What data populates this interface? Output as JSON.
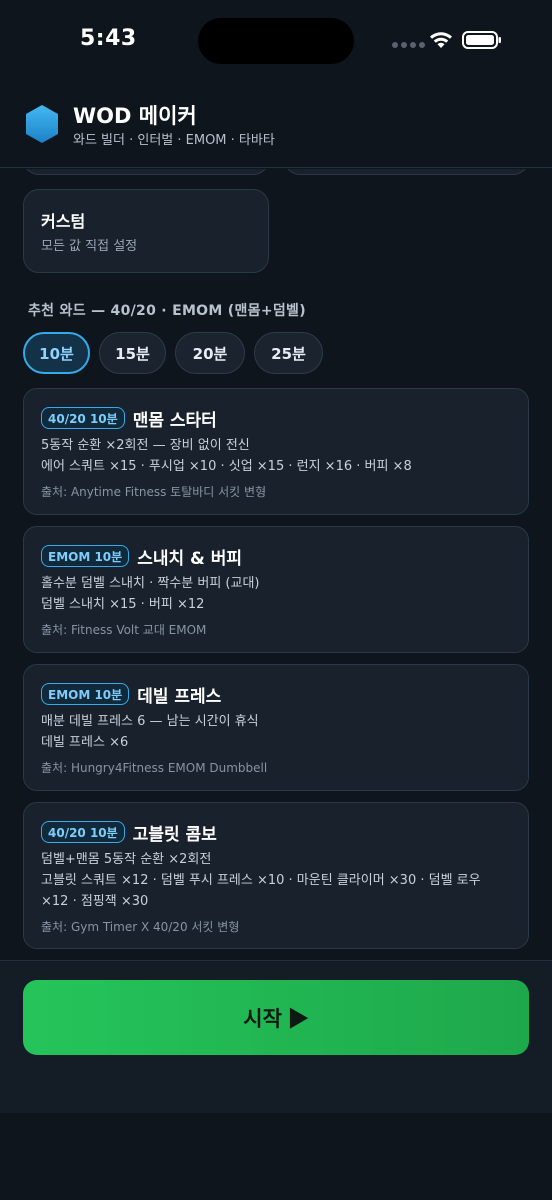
{
  "status_bar": {
    "time": "5:43"
  },
  "header": {
    "title": "WOD 메이커",
    "subtitle": "와드 빌더 · 인터벌 · EMOM · 타바타",
    "logo_color": "#2ea8e6"
  },
  "custom_card": {
    "title": "커스텀",
    "subtitle": "모든 값 직접 설정"
  },
  "recommended": {
    "title": "추천 와드 — 40/20 · EMOM (맨몸+덤벨)",
    "chips": [
      "10분",
      "15분",
      "20분",
      "25분"
    ],
    "selected_chip": "10분"
  },
  "cards": [
    {
      "badge": "40/20 10분",
      "title": "맨몸 스타터",
      "lines": [
        "5동작 순환 ×2회전 — 장비 없이 전신",
        "에어 스쿼트 ×15 · 푸시업 ×10 · 싯업 ×15 · 런지 ×16 · 버피 ×8"
      ],
      "source": "출처: Anytime Fitness 토탈바디 서킷 변형"
    },
    {
      "badge": "EMOM 10분",
      "title": "스내치 & 버피",
      "lines": [
        "홀수분 덤벨 스내치 · 짝수분 버피 (교대)",
        "덤벨 스내치 ×15 · 버피 ×12"
      ],
      "source": "출처: Fitness Volt 교대 EMOM"
    },
    {
      "badge": "EMOM 10분",
      "title": "데빌 프레스",
      "lines": [
        "매분 데빌 프레스 6 — 남는 시간이 휴식",
        "데빌 프레스 ×6"
      ],
      "source": "출처: Hungry4Fitness EMOM Dumbbell"
    },
    {
      "badge": "40/20 10분",
      "title": "고블릿 콤보",
      "lines": [
        "덤벨+맨몸 5동작 순환 ×2회전",
        "고블릿 스쿼트 ×12 · 덤벨 푸시 프레스 ×10 · 마운틴 클라이머 ×30 · 덤벨 로우",
        "×12 · 점핑잭 ×30"
      ],
      "source": "출처: Gym Timer X 40/20 서킷 변형"
    }
  ],
  "start_button": {
    "label": "시작 ▶"
  },
  "colors": {
    "accent": "#36a9e8",
    "start": "#22b955",
    "background": "#0f151d",
    "card": "#18212c"
  }
}
